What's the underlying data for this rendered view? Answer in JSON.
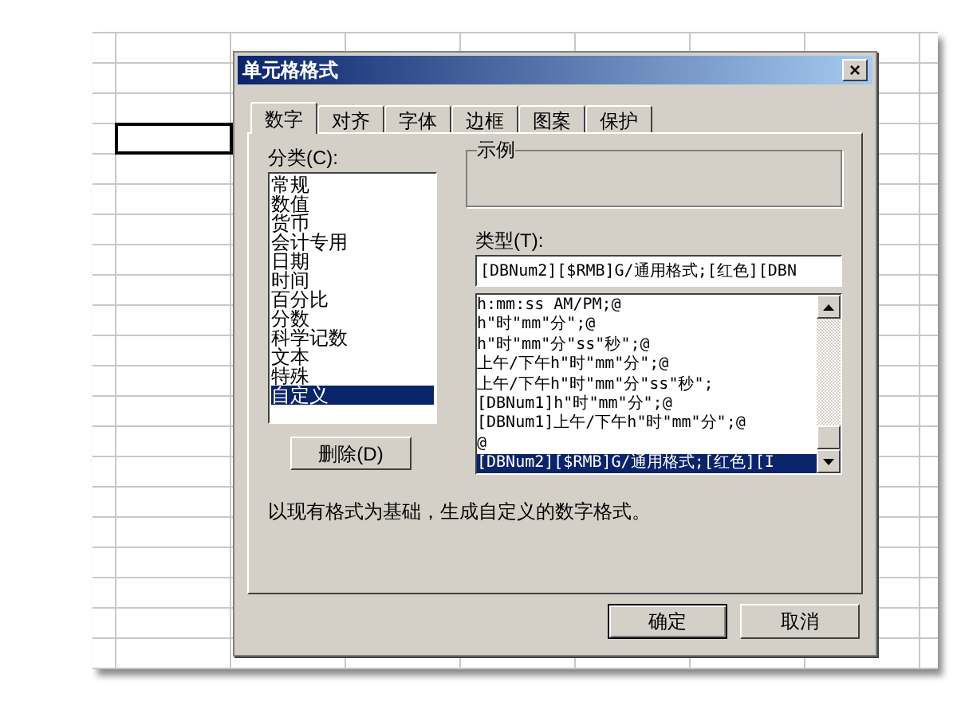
{
  "dialog": {
    "title": "单元格格式",
    "close": "×"
  },
  "tabs": [
    {
      "label": "数字",
      "selected": true
    },
    {
      "label": "对齐",
      "selected": false
    },
    {
      "label": "字体",
      "selected": false
    },
    {
      "label": "边框",
      "selected": false
    },
    {
      "label": "图案",
      "selected": false
    },
    {
      "label": "保护",
      "selected": false
    }
  ],
  "category": {
    "label": "分类(C):",
    "items": [
      {
        "label": "常规",
        "selected": false
      },
      {
        "label": "数值",
        "selected": false
      },
      {
        "label": "货币",
        "selected": false
      },
      {
        "label": "会计专用",
        "selected": false
      },
      {
        "label": "日期",
        "selected": false
      },
      {
        "label": "时间",
        "selected": false
      },
      {
        "label": "百分比",
        "selected": false
      },
      {
        "label": "分数",
        "selected": false
      },
      {
        "label": "科学记数",
        "selected": false
      },
      {
        "label": "文本",
        "selected": false
      },
      {
        "label": "特殊",
        "selected": false
      },
      {
        "label": "自定义",
        "selected": true
      }
    ],
    "delete_button": "删除(D)"
  },
  "sample": {
    "label": "示例"
  },
  "type": {
    "label": "类型(T):",
    "value": "[DBNum2][$RMB]G/通用格式;[红色][DBN",
    "items": [
      {
        "label": "h:mm:ss AM/PM;@",
        "selected": false
      },
      {
        "label": "h\"时\"mm\"分\";@",
        "selected": false
      },
      {
        "label": "h\"时\"mm\"分\"ss\"秒\";@",
        "selected": false
      },
      {
        "label": "上午/下午h\"时\"mm\"分\";@",
        "selected": false
      },
      {
        "label": "上午/下午h\"时\"mm\"分\"ss\"秒\";",
        "selected": false
      },
      {
        "label": "[DBNum1]h\"时\"mm\"分\";@",
        "selected": false
      },
      {
        "label": "[DBNum1]上午/下午h\"时\"mm\"分\";@",
        "selected": false
      },
      {
        "label": "@",
        "selected": false
      },
      {
        "label": "[DBNum2][$RMB]G/通用格式;[红色][I",
        "selected": true
      }
    ]
  },
  "description": "以现有格式为基础，生成自定义的数字格式。",
  "buttons": [
    "确定",
    "取消"
  ]
}
